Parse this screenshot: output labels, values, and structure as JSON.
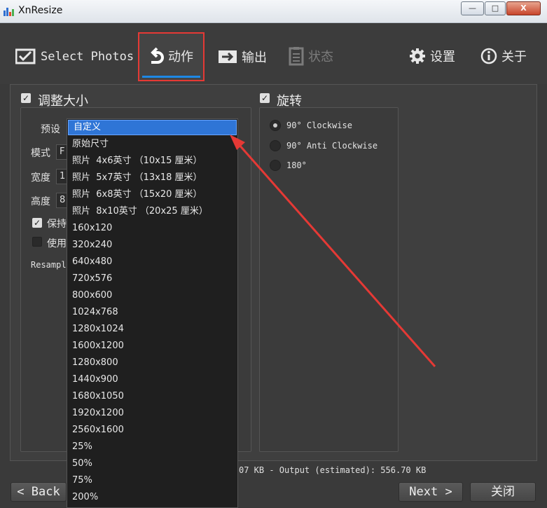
{
  "window": {
    "title": "XnResize",
    "minimize_label": "—",
    "maximize_label": "□",
    "close_label": "X"
  },
  "toolbar": {
    "select_photos": "Select Photos",
    "actions": "动作",
    "output": "输出",
    "status": "状态",
    "settings": "设置",
    "about": "关于"
  },
  "resize": {
    "header": "调整大小",
    "preset_label": "预设",
    "mode_label": "模式",
    "mode_value": "F",
    "width_label": "宽度",
    "width_value": "1",
    "height_label": "高度",
    "height_value": "8",
    "keep_ratio_label": "保持",
    "use_label": "使用",
    "resample_label": "Resampl"
  },
  "rotate": {
    "header": "旋转",
    "options": [
      {
        "label": "90°  Clockwise",
        "selected": true
      },
      {
        "label": "90°  Anti Clockwise",
        "selected": false
      },
      {
        "label": "180°",
        "selected": false
      }
    ]
  },
  "preset_dropdown": {
    "items": [
      "自定义",
      "原始尺寸",
      "照片  4x6英寸 （10x15 厘米）",
      "照片  5x7英寸 （13x18 厘米）",
      "照片  6x8英寸 （15x20 厘米）",
      "照片  8x10英寸 （20x25 厘米）",
      "160x120",
      "320x240",
      "640x480",
      "720x576",
      "800x600",
      "1024x768",
      "1280x1024",
      "1600x1200",
      "1280x800",
      "1440x900",
      "1680x1050",
      "1920x1200",
      "2560x1600",
      "25%",
      "50%",
      "75%",
      "200%"
    ],
    "selected_index": 0
  },
  "status_line": "07 KB - Output (estimated): 556.70 KB",
  "buttons": {
    "back": "< Back",
    "next": "Next >",
    "close": "关闭"
  },
  "colors": {
    "accent": "#2f75d6",
    "highlight_box": "#e53935",
    "annotation_arrow": "#e53935"
  }
}
